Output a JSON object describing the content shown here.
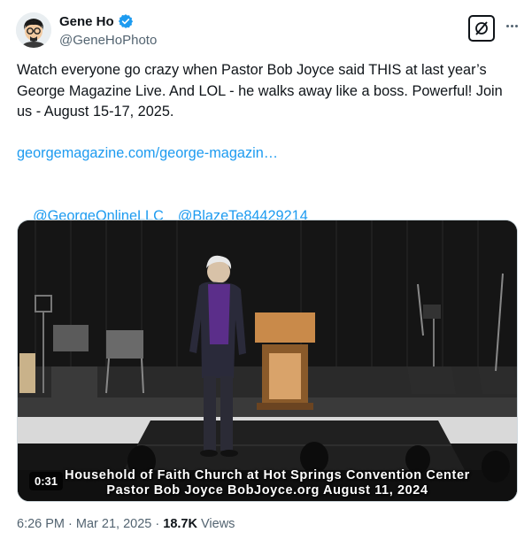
{
  "author": {
    "display_name": "Gene Ho",
    "handle": "@GeneHoPhoto",
    "verified": true,
    "avatar_icon": "cartoon-avatar-icon"
  },
  "header_actions": {
    "grok_icon": "grok-icon",
    "more_icon": "more-options-icon"
  },
  "tweet": {
    "text": "Watch everyone go crazy when Pastor Bob Joyce said THIS at last year’s George Magazine Live. And LOL - he walks away like a boss. Powerful! Join us - August 15-17, 2025.",
    "link": "georgemagazine.com/george-magazin…",
    "mentions": [
      "@GeorgeOnlineLLC",
      "@BlazeTe84429214"
    ]
  },
  "video": {
    "caption_line1": "Household of Faith Church at Hot Springs Convention Center",
    "caption_line2": "Pastor Bob Joyce    BobJoyce.org    August 11, 2024",
    "duration": "0:31"
  },
  "meta": {
    "time": "6:26 PM",
    "separator": "·",
    "date": "Mar 21, 2025",
    "views_count": "18.7K",
    "views_label": "Views"
  },
  "colors": {
    "link": "#1d9bf0",
    "secondary_text": "#536471",
    "primary_text": "#0f1419",
    "verified_badge": "#1d9bf0"
  }
}
